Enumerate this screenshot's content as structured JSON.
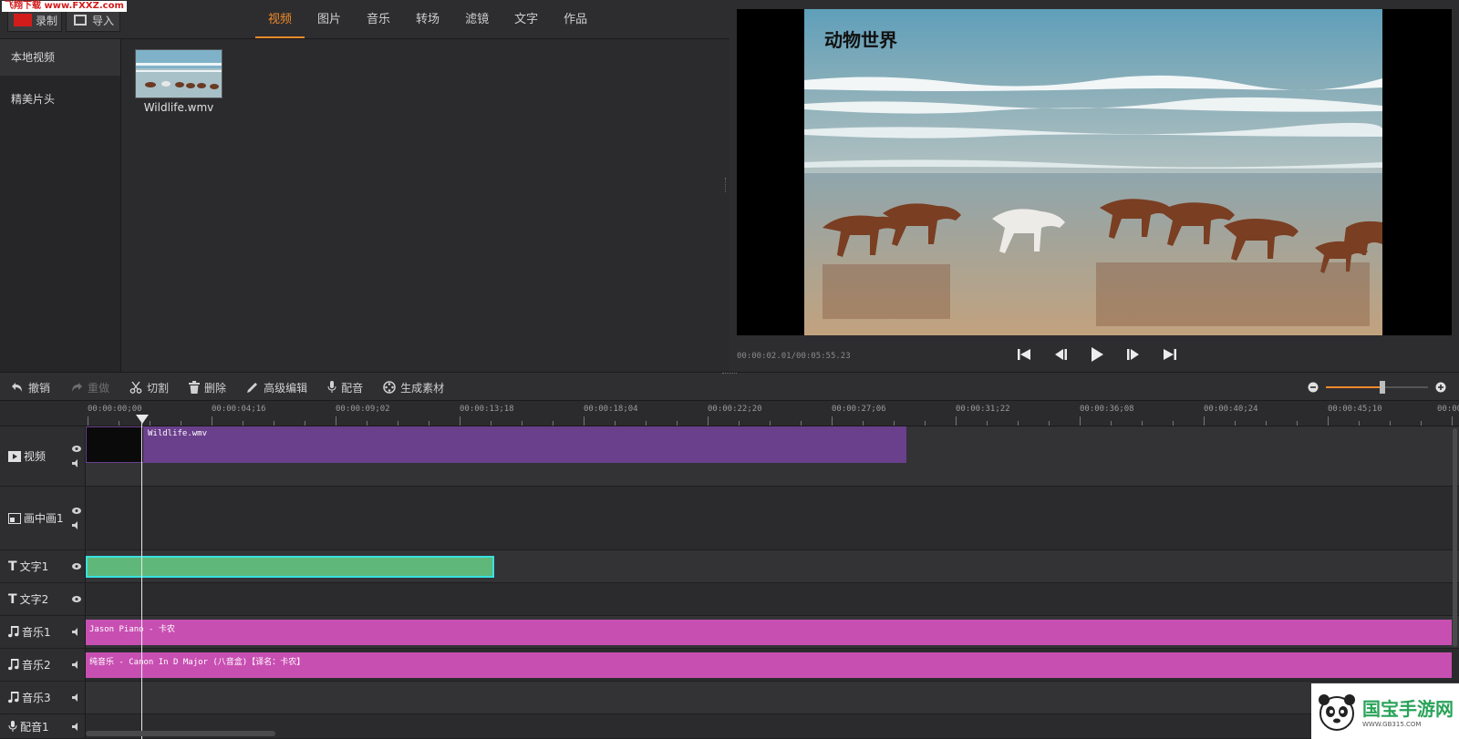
{
  "watermark": "飞翔下载 www.FXXZ.com",
  "library": {
    "record_label": "录制",
    "import_label": "导入",
    "tabs": [
      {
        "label": "视频",
        "active": true
      },
      {
        "label": "图片",
        "active": false
      },
      {
        "label": "音乐",
        "active": false
      },
      {
        "label": "转场",
        "active": false
      },
      {
        "label": "滤镜",
        "active": false
      },
      {
        "label": "文字",
        "active": false
      },
      {
        "label": "作品",
        "active": false
      }
    ],
    "side_items": [
      {
        "label": "本地视频",
        "active": true
      },
      {
        "label": "精美片头",
        "active": false
      }
    ],
    "media": [
      {
        "name": "Wildlife.wmv"
      }
    ]
  },
  "preview": {
    "video_title": "动物世界",
    "timecode": "00:00:02.01/00:05:55.23"
  },
  "toolbar": {
    "undo": "撤销",
    "redo": "重做",
    "cut": "切割",
    "delete": "删除",
    "advanced_edit": "高级编辑",
    "dub": "配音",
    "generate": "生成素材",
    "zoom_level": 0.55
  },
  "ruler": [
    "00:00:00;00",
    "00:00:04;16",
    "00:00:09;02",
    "00:00:13;18",
    "00:00:18;04",
    "00:00:22;20",
    "00:00:27;06",
    "00:00:31;22",
    "00:00:36;08",
    "00:00:40;24",
    "00:00:45;10",
    "00:00"
  ],
  "tracks": {
    "video": "视频",
    "pip": "画中画1",
    "text1": "文字1",
    "text2": "文字2",
    "music1": "音乐1",
    "music2": "音乐2",
    "music3": "音乐3",
    "dub1": "配音1"
  },
  "clips": {
    "video_clip": "Wildlife.wmv",
    "music1_clip": "Jason Piano - 卡农",
    "music2_clip": "纯音乐 - Canon In D Major (八音盒)【译名：卡农】"
  },
  "logo": {
    "name": "国宝手游网",
    "url": "WWW.GB315.COM"
  },
  "colors": {
    "accent": "#f08a2a",
    "video_clip": "#6a3f8c",
    "text_clip": "#5fb87a",
    "music_clip": "#c84fb2"
  }
}
